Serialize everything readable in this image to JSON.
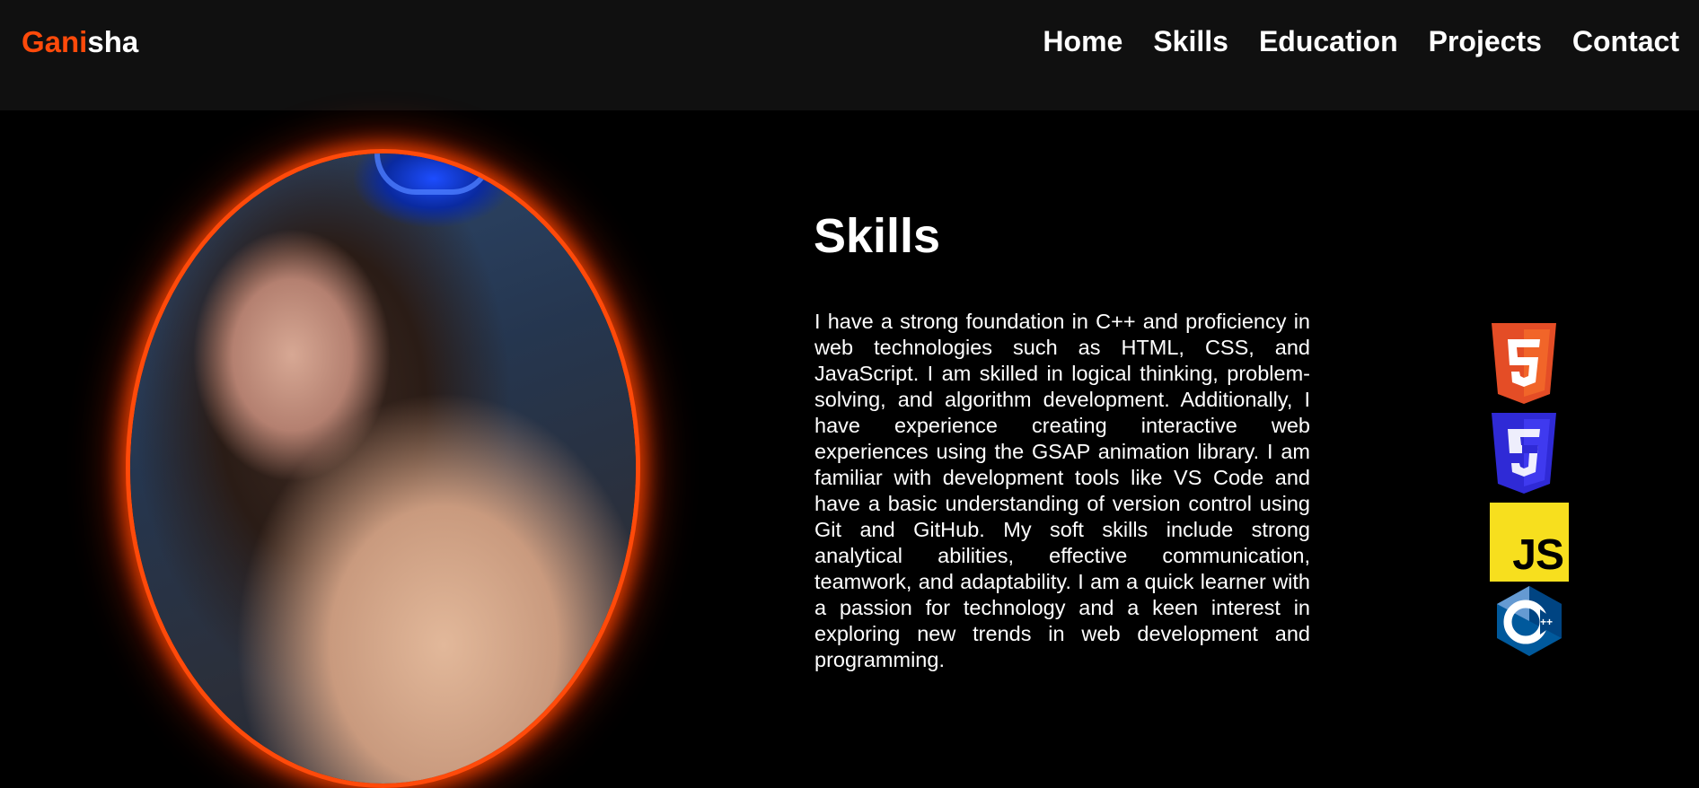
{
  "navbar": {
    "logo_accent": "Gani",
    "logo_rest": "sha",
    "links": [
      "Home",
      "Skills",
      "Education",
      "Projects",
      "Contact"
    ]
  },
  "skills": {
    "title": "Skills",
    "description": "I have a strong foundation in C++ and proficiency in web technologies such as HTML, CSS, and JavaScript. I am skilled in logical thinking, problem-solving, and algorithm development. Additionally, I have experience creating interactive web experiences using the GSAP animation library. I am familiar with development tools like VS Code and have a basic understanding of version control using Git and GitHub. My soft skills include strong analytical abilities, effective communication, teamwork, and adaptability. I am a quick learner with a passion for technology and a keen interest in exploring new trends in web development and programming.",
    "icons": [
      {
        "name": "html5-icon",
        "label": "5",
        "color": "#e44d26"
      },
      {
        "name": "css3-icon",
        "label": "3",
        "color": "#2f2ad6"
      },
      {
        "name": "javascript-icon",
        "label": "JS",
        "color": "#f7df1e"
      },
      {
        "name": "cpp-icon",
        "label": "C++",
        "color": "#00599c"
      }
    ]
  },
  "colors": {
    "accent": "#ff4a0a",
    "background": "#000000",
    "navbar": "#101010"
  }
}
